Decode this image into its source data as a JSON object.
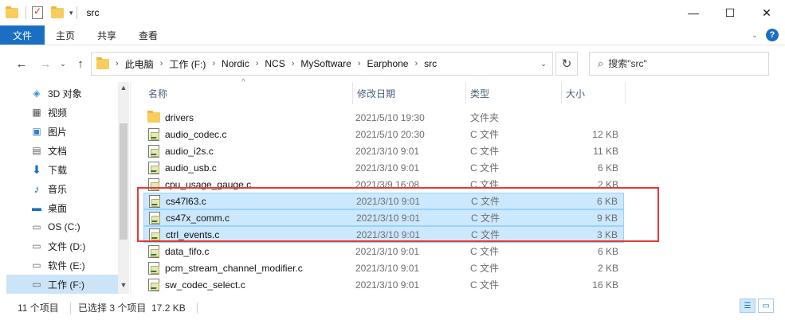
{
  "window": {
    "title": "src",
    "controls": {
      "minimize": "—",
      "maximize": "☐",
      "close": "✕"
    }
  },
  "ribbon": {
    "tabs": [
      "文件",
      "主页",
      "共享",
      "查看"
    ]
  },
  "nav": {
    "breadcrumbs": [
      "此电脑",
      "工作 (F:)",
      "Nordic",
      "NCS",
      "MySoftware",
      "Earphone",
      "src"
    ],
    "search_placeholder": "搜索\"src\""
  },
  "sidebar": {
    "items": [
      {
        "label": "3D 对象",
        "icon": "3d-objects-icon",
        "selected": false
      },
      {
        "label": "视频",
        "icon": "video-icon",
        "selected": false
      },
      {
        "label": "图片",
        "icon": "pictures-icon",
        "selected": false
      },
      {
        "label": "文档",
        "icon": "documents-icon",
        "selected": false
      },
      {
        "label": "下载",
        "icon": "download-icon",
        "selected": false
      },
      {
        "label": "音乐",
        "icon": "music-icon",
        "selected": false
      },
      {
        "label": "桌面",
        "icon": "desktop-icon",
        "selected": false
      },
      {
        "label": "OS (C:)",
        "icon": "drive-icon",
        "selected": false
      },
      {
        "label": "文件 (D:)",
        "icon": "drive-icon",
        "selected": false
      },
      {
        "label": "软件 (E:)",
        "icon": "drive-icon",
        "selected": false
      },
      {
        "label": "工作 (F:)",
        "icon": "drive-icon",
        "selected": true
      }
    ]
  },
  "columns": {
    "name": "名称",
    "date": "修改日期",
    "type": "类型",
    "size": "大小"
  },
  "files": [
    {
      "name": "drivers",
      "date": "2021/5/10 19:30",
      "type": "文件夹",
      "size": "",
      "kind": "folder",
      "selected": false
    },
    {
      "name": "audio_codec.c",
      "date": "2021/5/10 20:30",
      "type": "C 文件",
      "size": "12 KB",
      "kind": "c",
      "selected": false
    },
    {
      "name": "audio_i2s.c",
      "date": "2021/3/10 9:01",
      "type": "C 文件",
      "size": "11 KB",
      "kind": "c",
      "selected": false
    },
    {
      "name": "audio_usb.c",
      "date": "2021/3/10 9:01",
      "type": "C 文件",
      "size": "6 KB",
      "kind": "c",
      "selected": false
    },
    {
      "name": "cpu_usage_gauge.c",
      "date": "2021/3/9 16:08",
      "type": "C 文件",
      "size": "2 KB",
      "kind": "c",
      "selected": false
    },
    {
      "name": "cs47l63.c",
      "date": "2021/3/10 9:01",
      "type": "C 文件",
      "size": "6 KB",
      "kind": "c",
      "selected": true
    },
    {
      "name": "cs47x_comm.c",
      "date": "2021/3/10 9:01",
      "type": "C 文件",
      "size": "9 KB",
      "kind": "c",
      "selected": true
    },
    {
      "name": "ctrl_events.c",
      "date": "2021/3/10 9:01",
      "type": "C 文件",
      "size": "3 KB",
      "kind": "c",
      "selected": true
    },
    {
      "name": "data_fifo.c",
      "date": "2021/3/10 9:01",
      "type": "C 文件",
      "size": "6 KB",
      "kind": "c",
      "selected": false
    },
    {
      "name": "pcm_stream_channel_modifier.c",
      "date": "2021/3/10 9:01",
      "type": "C 文件",
      "size": "2 KB",
      "kind": "c",
      "selected": false
    },
    {
      "name": "sw_codec_select.c",
      "date": "2021/3/10 9:01",
      "type": "C 文件",
      "size": "16 KB",
      "kind": "c",
      "selected": false
    }
  ],
  "status": {
    "count": "11 个项目",
    "selection": "已选择 3 个项目  17.2 KB"
  },
  "colors": {
    "accent": "#1a6fc2",
    "selection_bg": "#cce8ff",
    "highlight_box": "#e53935"
  }
}
